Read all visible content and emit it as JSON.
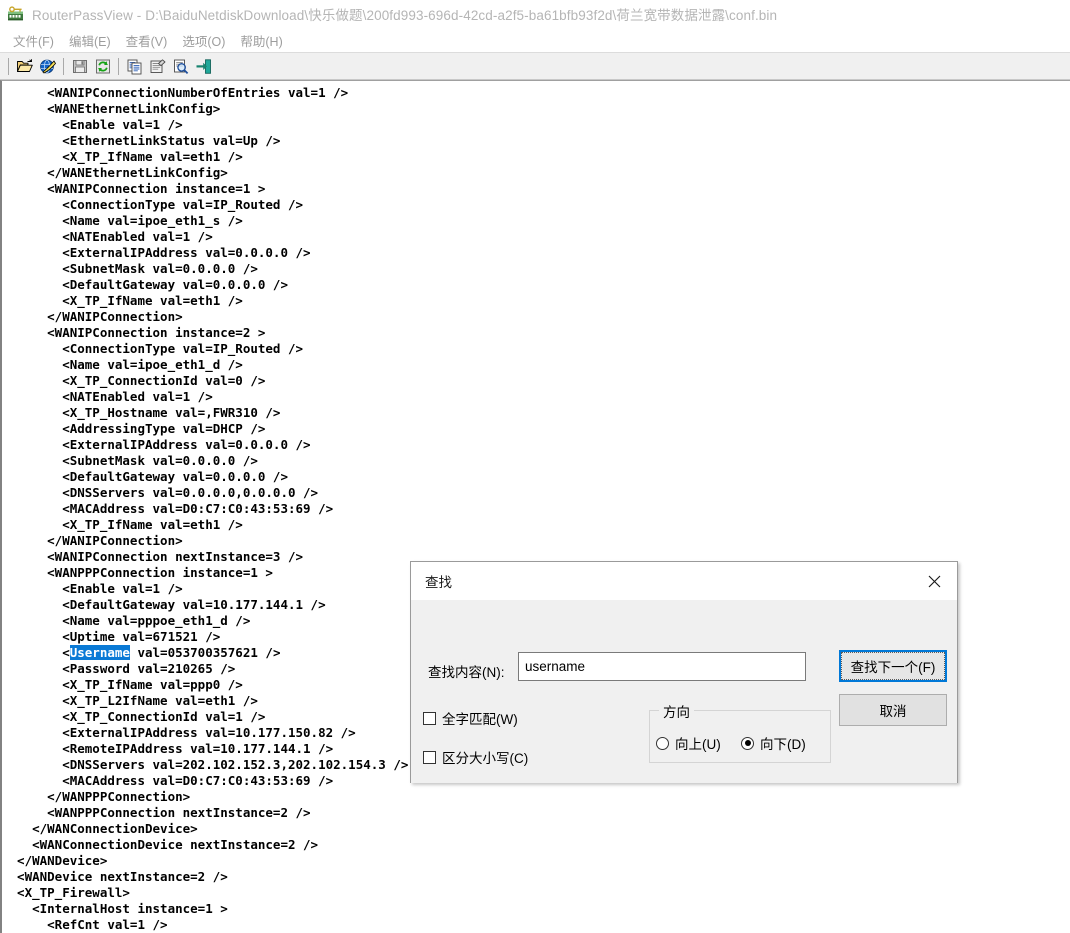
{
  "window": {
    "app_name": "RouterPassView",
    "separator": "-",
    "file_path": "D:\\BaiduNetdiskDownload\\快乐做题\\200fd993-696d-42cd-a2f5-ba61bfb93f2d\\荷兰宽带数据泄露\\conf.bin",
    "title_full": "RouterPassView  -  D:\\BaiduNetdiskDownload\\快乐做题\\200fd993-696d-42cd-a2f5-ba61bfb93f2d\\荷兰宽带数据泄露\\conf.bin",
    "icon": "router-key-icon",
    "title_color": "#b5b5b5"
  },
  "menubar": {
    "items": [
      {
        "label": "文件(F)",
        "name": "menu-file"
      },
      {
        "label": "编辑(E)",
        "name": "menu-edit"
      },
      {
        "label": "查看(V)",
        "name": "menu-view"
      },
      {
        "label": "选项(O)",
        "name": "menu-options"
      },
      {
        "label": "帮助(H)",
        "name": "menu-help"
      }
    ]
  },
  "toolbar": {
    "buttons": [
      {
        "icon": "open-folder-icon",
        "tooltip": "打开"
      },
      {
        "icon": "open-url-icon",
        "tooltip": "打开 URL"
      },
      {
        "icon": "save-icon",
        "tooltip": "保存"
      },
      {
        "icon": "refresh-icon",
        "tooltip": "刷新"
      },
      {
        "icon": "copy-icon",
        "tooltip": "复制"
      },
      {
        "icon": "properties-icon",
        "tooltip": "属性"
      },
      {
        "icon": "find-icon",
        "tooltip": "查找"
      },
      {
        "icon": "exit-icon",
        "tooltip": "退出"
      }
    ]
  },
  "editor": {
    "selection": {
      "text": "Username",
      "bg_color": "#0a7ad6",
      "fg_color": "#ffffff"
    },
    "lines": [
      "      <WANIPConnectionNumberOfEntries val=1 />",
      "      <WANEthernetLinkConfig>",
      "        <Enable val=1 />",
      "        <EthernetLinkStatus val=Up />",
      "        <X_TP_IfName val=eth1 />",
      "      </WANEthernetLinkConfig>",
      "      <WANIPConnection instance=1 >",
      "        <ConnectionType val=IP_Routed />",
      "        <Name val=ipoe_eth1_s />",
      "        <NATEnabled val=1 />",
      "        <ExternalIPAddress val=0.0.0.0 />",
      "        <SubnetMask val=0.0.0.0 />",
      "        <DefaultGateway val=0.0.0.0 />",
      "        <X_TP_IfName val=eth1 />",
      "      </WANIPConnection>",
      "      <WANIPConnection instance=2 >",
      "        <ConnectionType val=IP_Routed />",
      "        <Name val=ipoe_eth1_d />",
      "        <X_TP_ConnectionId val=0 />",
      "        <NATEnabled val=1 />",
      "        <X_TP_Hostname val=,FWR310 />",
      "        <AddressingType val=DHCP />",
      "        <ExternalIPAddress val=0.0.0.0 />",
      "        <SubnetMask val=0.0.0.0 />",
      "        <DefaultGateway val=0.0.0.0 />",
      "        <DNSServers val=0.0.0.0,0.0.0.0 />",
      "        <MACAddress val=D0:C7:C0:43:53:69 />",
      "        <X_TP_IfName val=eth1 />",
      "      </WANIPConnection>",
      "      <WANIPConnection nextInstance=3 />",
      "      <WANPPPConnection instance=1 >",
      "        <Enable val=1 />",
      "        <DefaultGateway val=10.177.144.1 />",
      "        <Name val=pppoe_eth1_d />",
      "        <Uptime val=671521 />",
      "SELECTION_LINE",
      "        <Password val=210265 />",
      "        <X_TP_IfName val=ppp0 />",
      "        <X_TP_L2IfName val=eth1 />",
      "        <X_TP_ConnectionId val=1 />",
      "        <ExternalIPAddress val=10.177.150.82 />",
      "        <RemoteIPAddress val=10.177.144.1 />",
      "        <DNSServers val=202.102.152.3,202.102.154.3 />",
      "        <MACAddress val=D0:C7:C0:43:53:69 />",
      "      </WANPPPConnection>",
      "      <WANPPPConnection nextInstance=2 />",
      "    </WANConnectionDevice>",
      "    <WANConnectionDevice nextInstance=2 />",
      "  </WANDevice>",
      "  <WANDevice nextInstance=2 />",
      "  <X_TP_Firewall>",
      "    <InternalHost instance=1 >",
      "      <RefCnt val=1 />"
    ],
    "selection_line": {
      "prefix": "        <",
      "selected": "Username",
      "suffix": " val=053700357621 />"
    }
  },
  "find_dialog": {
    "title": "查找",
    "close_icon": "close-icon",
    "find_what_label": "查找内容(N):",
    "find_what_value": "username",
    "find_what_placeholder": "",
    "whole_word_label": "全字匹配(W)",
    "whole_word_checked": false,
    "match_case_label": "区分大小写(C)",
    "match_case_checked": false,
    "direction_legend": "方向",
    "direction_up_label": "向上(U)",
    "direction_down_label": "向下(D)",
    "direction_selected": "down",
    "find_next_label": "查找下一个(F)",
    "cancel_label": "取消",
    "focus_color": "#0078d7"
  }
}
